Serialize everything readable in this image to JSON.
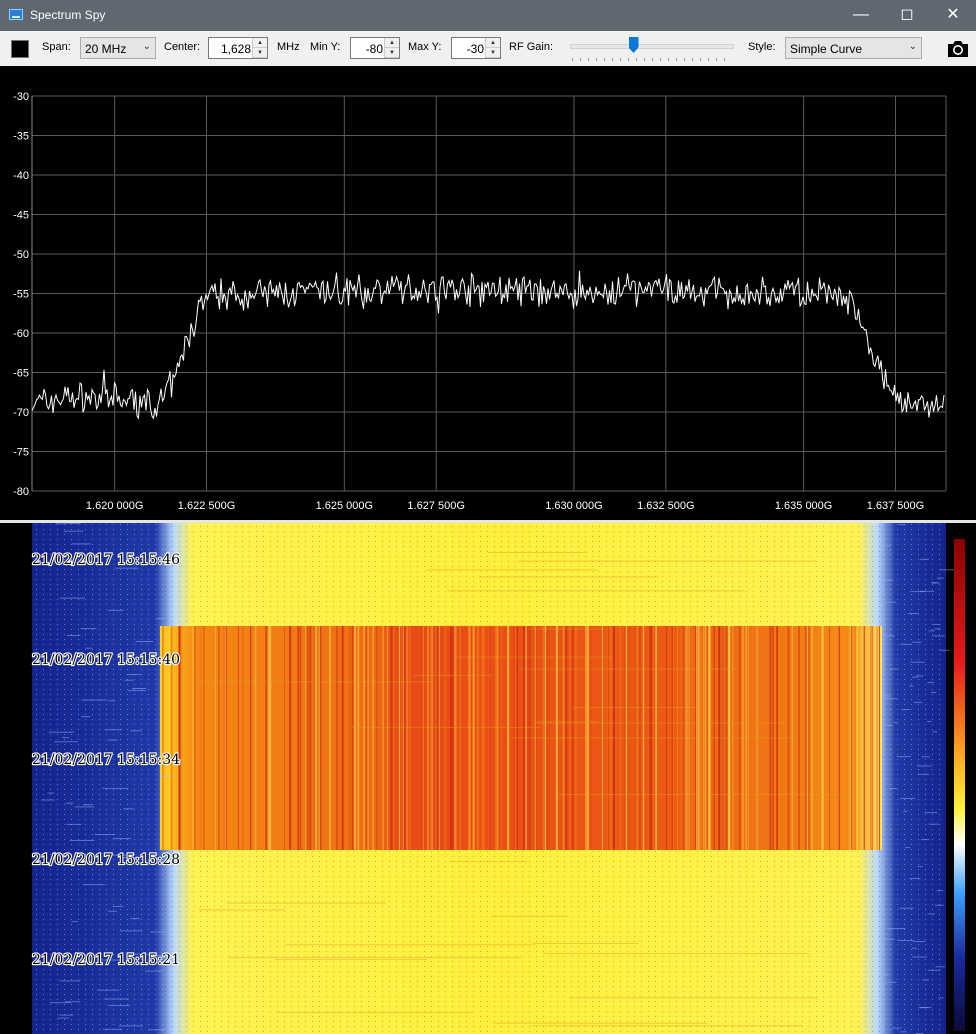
{
  "window": {
    "title": "Spectrum Spy"
  },
  "toolbar": {
    "span_label": "Span:",
    "span_value": "20 MHz",
    "center_label": "Center:",
    "center_value": "1,628",
    "center_unit": "MHz",
    "miny_label": "Min Y:",
    "miny_value": "-80",
    "maxy_label": "Max Y:",
    "maxy_value": "-30",
    "rfgain_label": "RF Gain:",
    "rfgain_level": 0.38,
    "style_label": "Style:",
    "style_value": "Simple Curve",
    "trace_color": "#000000"
  },
  "chart_data": {
    "type": "line",
    "title": "",
    "xlabel": "",
    "ylabel": "",
    "ylim": [
      -80,
      -30
    ],
    "xlim": [
      1.6182,
      1.6381
    ],
    "yticks": [
      "-30",
      "-35",
      "-40",
      "-45",
      "-50",
      "-55",
      "-60",
      "-65",
      "-70",
      "-75",
      "-80"
    ],
    "xticks": [
      "1.620 000G",
      "1.622 500G",
      "1.625 000G",
      "1.627 500G",
      "1.630 000G",
      "1.632 500G",
      "1.635 000G",
      "1.637 500G"
    ],
    "grid": true,
    "line_color": "#ffffff",
    "series": [
      {
        "x": [
          1.6182,
          1.619,
          1.62,
          1.621,
          1.6213,
          1.6216,
          1.6219,
          1.6222,
          1.6225,
          1.624,
          1.626,
          1.628,
          1.63,
          1.632,
          1.634,
          1.6355,
          1.636,
          1.6363,
          1.6366,
          1.6369,
          1.6372,
          1.638
        ],
        "y": [
          -69,
          -68,
          -68.5,
          -69,
          -66,
          -61,
          -56,
          -55,
          -55,
          -55,
          -54.5,
          -54.5,
          -55,
          -54.5,
          -55,
          -55,
          -56,
          -60,
          -64.5,
          -68,
          -69,
          -69
        ]
      }
    ]
  },
  "waterfall": {
    "timestamps": [
      "21/02/2017 15:15:46",
      "21/02/2017 15:15:40",
      "21/02/2017 15:15:34",
      "21/02/2017 15:15:28",
      "21/02/2017 15:15:21"
    ],
    "colors": {
      "low": "#0a1a8a",
      "mid": "#fff23a",
      "high": "#e8381a"
    }
  },
  "icons": {
    "minimize": "minimize-icon",
    "maximize": "maximize-icon",
    "close": "close-icon",
    "camera": "camera-icon"
  }
}
